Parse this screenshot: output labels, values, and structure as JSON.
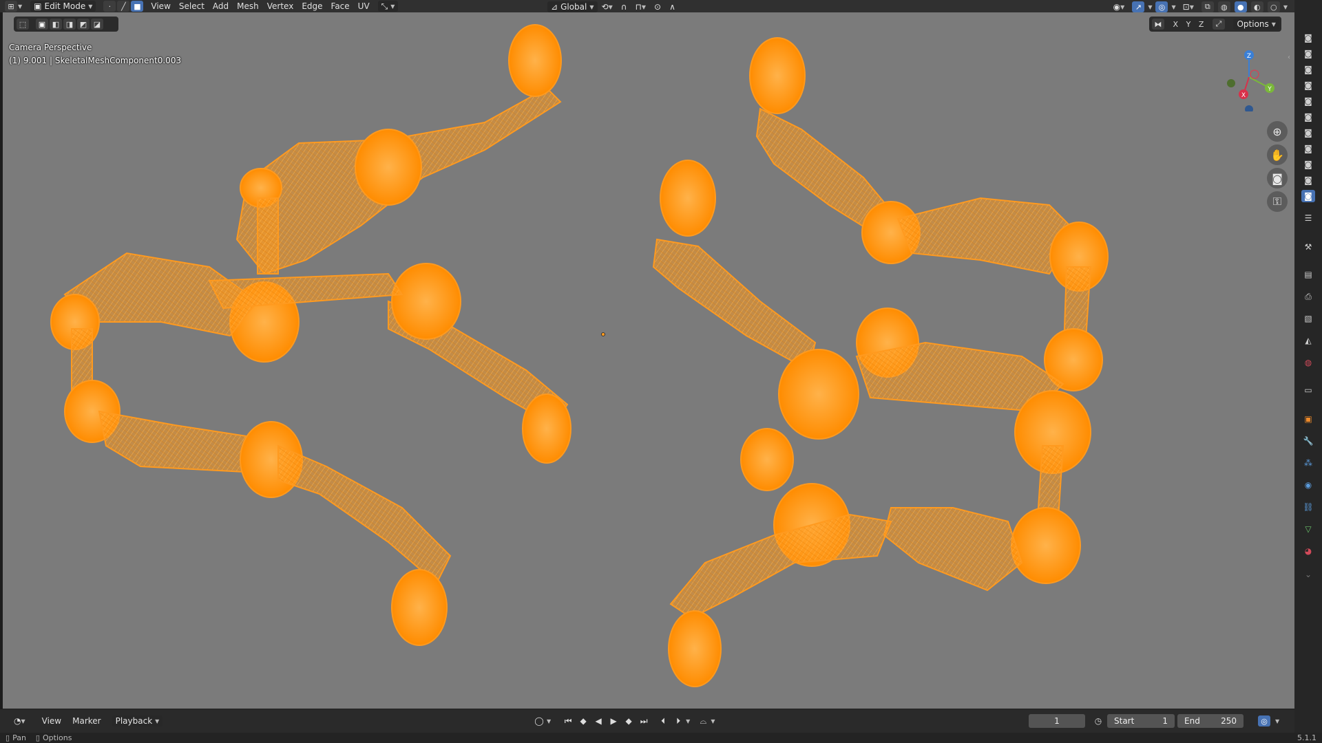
{
  "header": {
    "mode": "Edit Mode",
    "menus": [
      "View",
      "Select",
      "Add",
      "Mesh",
      "Vertex",
      "Edge",
      "Face",
      "UV"
    ],
    "transform_orientation": "Global"
  },
  "viewport": {
    "camera_label": "Camera Perspective",
    "object_label": "(1) 9.001 | SkeletalMeshComponent0.003",
    "options_label": "Options",
    "axis_lock": [
      "X",
      "Y",
      "Z"
    ],
    "gizmo_axes": [
      "Z",
      "Y",
      "X"
    ],
    "wire_color": "#ff9a1f",
    "background_color": "#7b7b7b"
  },
  "timeline": {
    "menus": [
      "View",
      "Marker",
      "Playback"
    ],
    "current_frame": "1",
    "start_label": "Start",
    "start_value": "1",
    "end_label": "End",
    "end_value": "250"
  },
  "statusbar": {
    "pan": "Pan",
    "options": "Options",
    "version": "5.1.1"
  }
}
